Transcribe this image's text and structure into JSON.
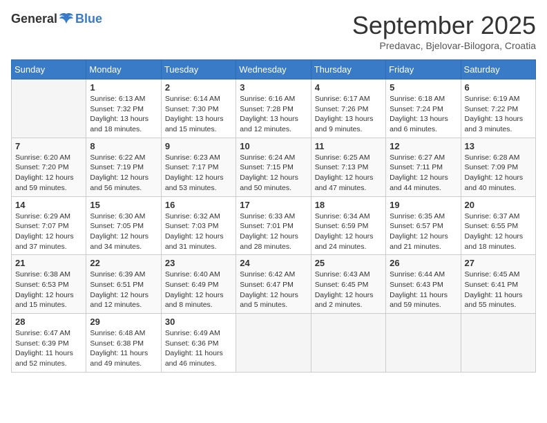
{
  "header": {
    "logo_general": "General",
    "logo_blue": "Blue",
    "month": "September 2025",
    "location": "Predavac, Bjelovar-Bilogora, Croatia"
  },
  "weekdays": [
    "Sunday",
    "Monday",
    "Tuesday",
    "Wednesday",
    "Thursday",
    "Friday",
    "Saturday"
  ],
  "weeks": [
    [
      {
        "day": "",
        "content": ""
      },
      {
        "day": "1",
        "content": "Sunrise: 6:13 AM\nSunset: 7:32 PM\nDaylight: 13 hours\nand 18 minutes."
      },
      {
        "day": "2",
        "content": "Sunrise: 6:14 AM\nSunset: 7:30 PM\nDaylight: 13 hours\nand 15 minutes."
      },
      {
        "day": "3",
        "content": "Sunrise: 6:16 AM\nSunset: 7:28 PM\nDaylight: 13 hours\nand 12 minutes."
      },
      {
        "day": "4",
        "content": "Sunrise: 6:17 AM\nSunset: 7:26 PM\nDaylight: 13 hours\nand 9 minutes."
      },
      {
        "day": "5",
        "content": "Sunrise: 6:18 AM\nSunset: 7:24 PM\nDaylight: 13 hours\nand 6 minutes."
      },
      {
        "day": "6",
        "content": "Sunrise: 6:19 AM\nSunset: 7:22 PM\nDaylight: 13 hours\nand 3 minutes."
      }
    ],
    [
      {
        "day": "7",
        "content": "Sunrise: 6:20 AM\nSunset: 7:20 PM\nDaylight: 12 hours\nand 59 minutes."
      },
      {
        "day": "8",
        "content": "Sunrise: 6:22 AM\nSunset: 7:19 PM\nDaylight: 12 hours\nand 56 minutes."
      },
      {
        "day": "9",
        "content": "Sunrise: 6:23 AM\nSunset: 7:17 PM\nDaylight: 12 hours\nand 53 minutes."
      },
      {
        "day": "10",
        "content": "Sunrise: 6:24 AM\nSunset: 7:15 PM\nDaylight: 12 hours\nand 50 minutes."
      },
      {
        "day": "11",
        "content": "Sunrise: 6:25 AM\nSunset: 7:13 PM\nDaylight: 12 hours\nand 47 minutes."
      },
      {
        "day": "12",
        "content": "Sunrise: 6:27 AM\nSunset: 7:11 PM\nDaylight: 12 hours\nand 44 minutes."
      },
      {
        "day": "13",
        "content": "Sunrise: 6:28 AM\nSunset: 7:09 PM\nDaylight: 12 hours\nand 40 minutes."
      }
    ],
    [
      {
        "day": "14",
        "content": "Sunrise: 6:29 AM\nSunset: 7:07 PM\nDaylight: 12 hours\nand 37 minutes."
      },
      {
        "day": "15",
        "content": "Sunrise: 6:30 AM\nSunset: 7:05 PM\nDaylight: 12 hours\nand 34 minutes."
      },
      {
        "day": "16",
        "content": "Sunrise: 6:32 AM\nSunset: 7:03 PM\nDaylight: 12 hours\nand 31 minutes."
      },
      {
        "day": "17",
        "content": "Sunrise: 6:33 AM\nSunset: 7:01 PM\nDaylight: 12 hours\nand 28 minutes."
      },
      {
        "day": "18",
        "content": "Sunrise: 6:34 AM\nSunset: 6:59 PM\nDaylight: 12 hours\nand 24 minutes."
      },
      {
        "day": "19",
        "content": "Sunrise: 6:35 AM\nSunset: 6:57 PM\nDaylight: 12 hours\nand 21 minutes."
      },
      {
        "day": "20",
        "content": "Sunrise: 6:37 AM\nSunset: 6:55 PM\nDaylight: 12 hours\nand 18 minutes."
      }
    ],
    [
      {
        "day": "21",
        "content": "Sunrise: 6:38 AM\nSunset: 6:53 PM\nDaylight: 12 hours\nand 15 minutes."
      },
      {
        "day": "22",
        "content": "Sunrise: 6:39 AM\nSunset: 6:51 PM\nDaylight: 12 hours\nand 12 minutes."
      },
      {
        "day": "23",
        "content": "Sunrise: 6:40 AM\nSunset: 6:49 PM\nDaylight: 12 hours\nand 8 minutes."
      },
      {
        "day": "24",
        "content": "Sunrise: 6:42 AM\nSunset: 6:47 PM\nDaylight: 12 hours\nand 5 minutes."
      },
      {
        "day": "25",
        "content": "Sunrise: 6:43 AM\nSunset: 6:45 PM\nDaylight: 12 hours\nand 2 minutes."
      },
      {
        "day": "26",
        "content": "Sunrise: 6:44 AM\nSunset: 6:43 PM\nDaylight: 11 hours\nand 59 minutes."
      },
      {
        "day": "27",
        "content": "Sunrise: 6:45 AM\nSunset: 6:41 PM\nDaylight: 11 hours\nand 55 minutes."
      }
    ],
    [
      {
        "day": "28",
        "content": "Sunrise: 6:47 AM\nSunset: 6:39 PM\nDaylight: 11 hours\nand 52 minutes."
      },
      {
        "day": "29",
        "content": "Sunrise: 6:48 AM\nSunset: 6:38 PM\nDaylight: 11 hours\nand 49 minutes."
      },
      {
        "day": "30",
        "content": "Sunrise: 6:49 AM\nSunset: 6:36 PM\nDaylight: 11 hours\nand 46 minutes."
      },
      {
        "day": "",
        "content": ""
      },
      {
        "day": "",
        "content": ""
      },
      {
        "day": "",
        "content": ""
      },
      {
        "day": "",
        "content": ""
      }
    ]
  ]
}
